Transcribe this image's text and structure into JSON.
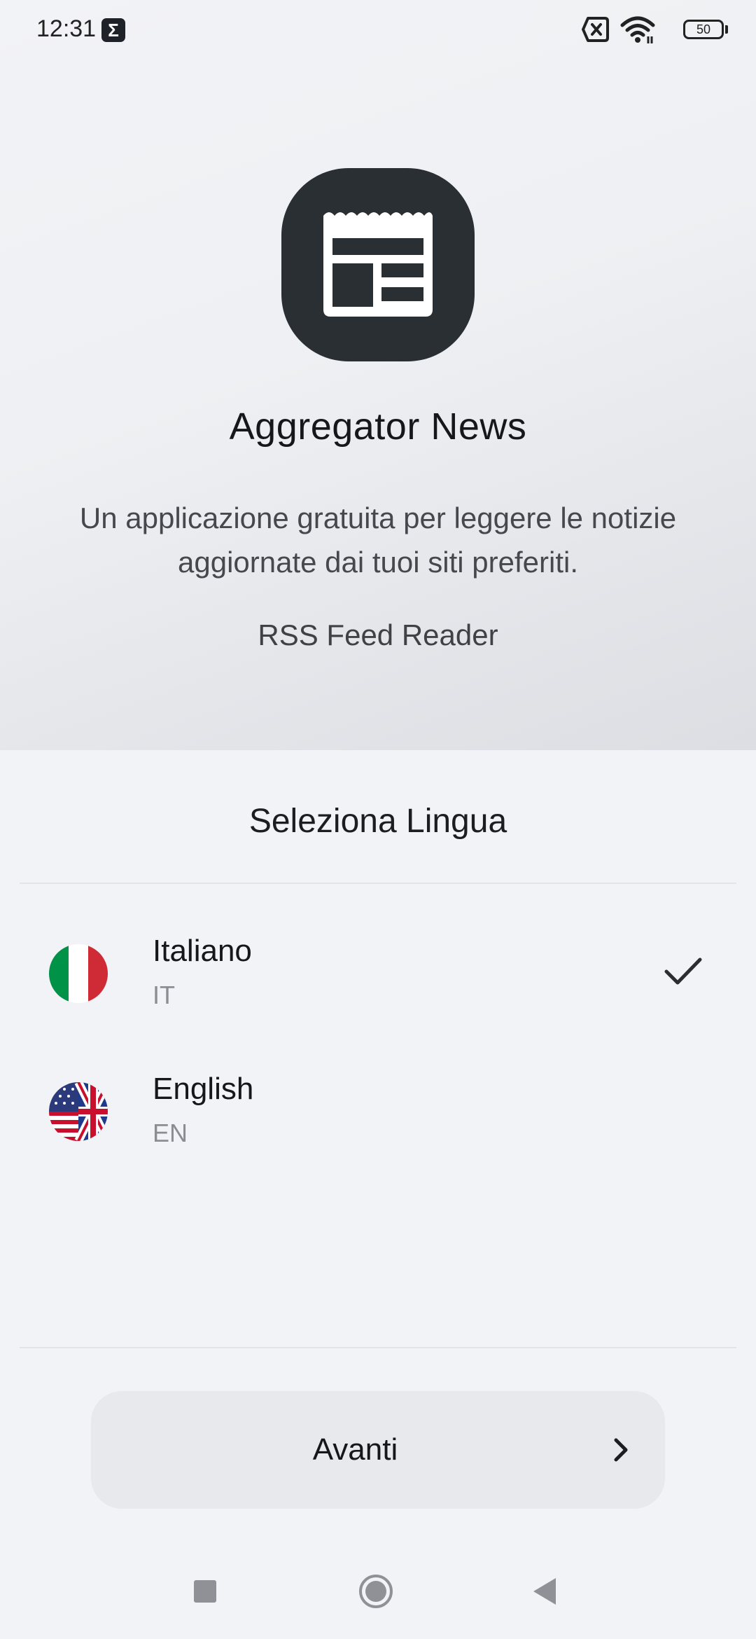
{
  "status_bar": {
    "time": "12:31",
    "notification_icon": "sigma-app-icon",
    "battery_level": "50",
    "icons": [
      "sim-off-icon",
      "wifi-icon",
      "battery-icon"
    ]
  },
  "app": {
    "logo_icon": "newspaper-icon",
    "title": "Aggregator News",
    "description": "Un applicazione gratuita per leggere le notizie aggiornate dai tuoi siti preferiti.",
    "tagline": "RSS Feed Reader"
  },
  "language_section": {
    "title": "Seleziona Lingua",
    "options": [
      {
        "name": "Italiano",
        "code": "IT",
        "flag_icon": "italy-flag-icon",
        "selected": true
      },
      {
        "name": "English",
        "code": "EN",
        "flag_icon": "us-uk-flag-icon",
        "selected": false
      }
    ]
  },
  "next_button": {
    "label": "Avanti",
    "icon": "chevron-right-icon"
  },
  "nav_bar": {
    "icons": [
      "recents-icon",
      "home-icon",
      "back-icon"
    ]
  },
  "colors": {
    "background": "#f2f3f7",
    "logo_bg": "#2a2f33",
    "button_bg": "#e7e9ed",
    "italy_green": "#009246",
    "italy_red": "#ce2b37"
  }
}
